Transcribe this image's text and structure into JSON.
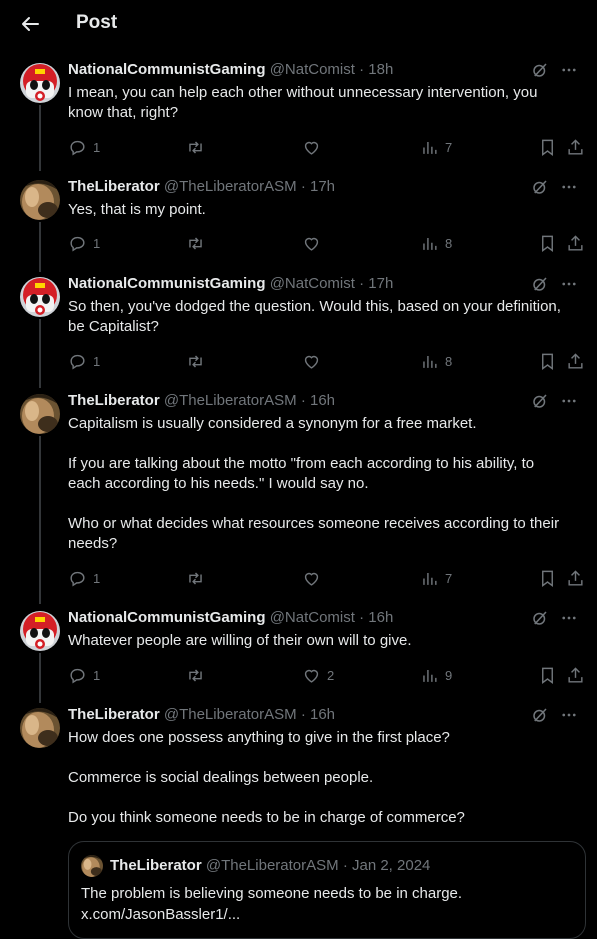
{
  "header": {
    "title": "Post"
  },
  "tweets": [
    {
      "name": "NationalCommunistGaming",
      "handle": "@NatComist",
      "time": "18h",
      "lines": [
        "I mean, you can help each other without unnecessary intervention, you know that, right?"
      ],
      "replies": "1",
      "retweets": "",
      "likes": "",
      "views": "7"
    },
    {
      "name": "TheLiberator",
      "handle": "@TheLiberatorASM",
      "time": "17h",
      "lines": [
        "Yes, that is my point."
      ],
      "replies": "1",
      "retweets": "",
      "likes": "",
      "views": "8"
    },
    {
      "name": "NationalCommunistGaming",
      "handle": "@NatComist",
      "time": "17h",
      "lines": [
        "So then, you've dodged the question. Would this, based on your definition, be Capitalist?"
      ],
      "replies": "1",
      "retweets": "",
      "likes": "",
      "views": "8"
    },
    {
      "name": "TheLiberator",
      "handle": "@TheLiberatorASM",
      "time": "16h",
      "lines": [
        "Capitalism is usually considered a synonym for a free market.",
        "",
        "If you are talking about the motto \"from each according to his ability, to each according to his needs.\" I would say no.",
        "",
        "Who or what decides what resources someone receives according to their needs?"
      ],
      "replies": "1",
      "retweets": "",
      "likes": "",
      "views": "7"
    },
    {
      "name": "NationalCommunistGaming",
      "handle": "@NatComist",
      "time": "16h",
      "lines": [
        "Whatever people are willing of their own will to give."
      ],
      "replies": "1",
      "retweets": "",
      "likes": "2",
      "views": "9"
    },
    {
      "name": "TheLiberator",
      "handle": "@TheLiberatorASM",
      "time": "16h",
      "lines": [
        "How does one possess anything to give in the first place?",
        "",
        "Commerce is social dealings between people.",
        "",
        "Do you think someone needs to be in charge of commerce?"
      ]
    }
  ],
  "quote": {
    "name": "TheLiberator",
    "handle": "@TheLiberatorASM",
    "date": "Jan 2, 2024",
    "line1": "The problem is believing someone needs to be in charge.",
    "line2": "x.com/JasonBassler1/..."
  },
  "separator": "·",
  "icons": {
    "back": "arrow-left-icon",
    "grok": "grok-icon",
    "more": "more-dots-icon",
    "reply": "reply-icon",
    "retweet": "retweet-icon",
    "like": "heart-icon",
    "views": "views-icon",
    "bookmark": "bookmark-icon",
    "share": "share-icon"
  },
  "colors": {
    "background": "#000000",
    "text": "#e7e9ea",
    "muted": "#71767b",
    "border": "#2f3336"
  }
}
